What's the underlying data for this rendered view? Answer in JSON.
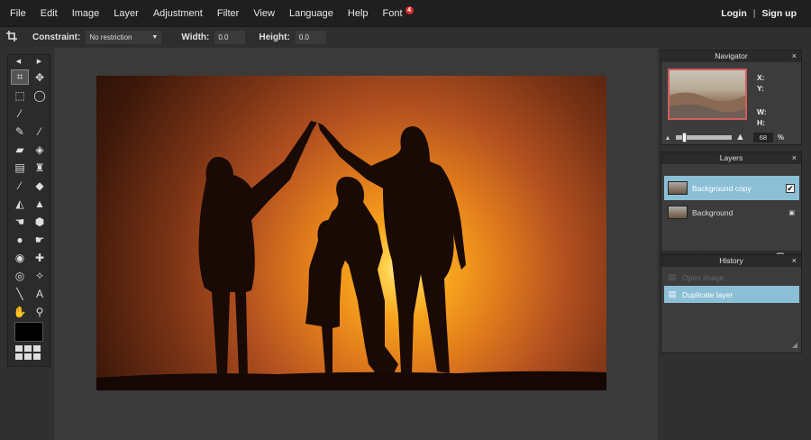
{
  "menu": {
    "items": [
      "File",
      "Edit",
      "Image",
      "Layer",
      "Adjustment",
      "Filter",
      "View",
      "Language",
      "Help",
      "Font"
    ],
    "font_badge": "4",
    "login": "Login",
    "separator": "|",
    "signup": "Sign up"
  },
  "options": {
    "constraint_label": "Constraint:",
    "constraint_value": "No restriction",
    "width_label": "Width:",
    "width_value": "0.0",
    "height_label": "Height:",
    "height_value": "0.0"
  },
  "toolbox": {
    "nav_prev": "◀",
    "nav_next": "▶",
    "tools": [
      {
        "name": "crop-tool",
        "icon": "crop-icon",
        "glyph": "⌗",
        "active": true
      },
      {
        "name": "move-tool",
        "icon": "move-icon",
        "glyph": "✥"
      },
      {
        "name": "marquee-tool",
        "icon": "marquee-icon",
        "glyph": "⬚"
      },
      {
        "name": "lasso-tool",
        "icon": "lasso-icon",
        "glyph": "◯"
      },
      {
        "name": "magic-wand-tool",
        "icon": "magic-wand-icon",
        "glyph": "⁄"
      },
      {
        "name": "empty-slot",
        "icon": "",
        "glyph": ""
      },
      {
        "name": "pencil-tool",
        "icon": "pencil-icon",
        "glyph": "✎"
      },
      {
        "name": "brush-tool",
        "icon": "brush-icon",
        "glyph": "⁄"
      },
      {
        "name": "eraser-tool",
        "icon": "eraser-icon",
        "glyph": "▰"
      },
      {
        "name": "fill-tool",
        "icon": "bucket-icon",
        "glyph": "◈"
      },
      {
        "name": "gradient-tool",
        "icon": "gradient-icon",
        "glyph": "▤"
      },
      {
        "name": "stamp-tool",
        "icon": "stamp-icon",
        "glyph": "♜"
      },
      {
        "name": "color-picker-tool",
        "icon": "dropper-icon",
        "glyph": "⁄"
      },
      {
        "name": "replace-color-tool",
        "icon": "replace-color-icon",
        "glyph": "◆"
      },
      {
        "name": "sharpen-tool",
        "icon": "sharpen-icon",
        "glyph": "◭"
      },
      {
        "name": "blur-tool",
        "icon": "blur-drop-icon",
        "glyph": "▲"
      },
      {
        "name": "smudge-tool",
        "icon": "smudge-icon",
        "glyph": "☚"
      },
      {
        "name": "sponge-tool",
        "icon": "sponge-icon",
        "glyph": "⬢"
      },
      {
        "name": "dodge-tool",
        "icon": "dodge-icon",
        "glyph": "●"
      },
      {
        "name": "burn-tool",
        "icon": "burn-icon",
        "glyph": "☛"
      },
      {
        "name": "red-eye-tool",
        "icon": "eye-icon",
        "glyph": "◉"
      },
      {
        "name": "spot-heal-tool",
        "icon": "bandage-icon",
        "glyph": "✚"
      },
      {
        "name": "bloat-tool",
        "icon": "bloat-icon",
        "glyph": "◎"
      },
      {
        "name": "pinch-tool",
        "icon": "pinch-icon",
        "glyph": "✧"
      },
      {
        "name": "draw-tool",
        "icon": "line-icon",
        "glyph": "╲"
      },
      {
        "name": "text-tool",
        "icon": "text-icon",
        "glyph": "A"
      },
      {
        "name": "hand-tool",
        "icon": "hand-icon",
        "glyph": "✋"
      },
      {
        "name": "zoom-tool",
        "icon": "zoom-icon",
        "glyph": "⚲"
      }
    ]
  },
  "navigator": {
    "title": "Navigator",
    "close": "×",
    "x_label": "X:",
    "y_label": "Y:",
    "w_label": "W:",
    "h_label": "H:",
    "zoom_value": "68",
    "zoom_percent": "%",
    "zoom_level": 0.12
  },
  "layers": {
    "title": "Layers",
    "close": "×",
    "items": [
      {
        "name": "Background copy",
        "selected": true,
        "right": "✔"
      },
      {
        "name": "Background",
        "selected": false,
        "right": "🔒"
      }
    ],
    "footer_icons": [
      "layer-settings-icon",
      "layer-mask-icon",
      "layer-styles-icon",
      "new-layer-icon",
      "delete-layer-icon"
    ]
  },
  "history": {
    "title": "History",
    "close": "×",
    "items": [
      {
        "name": "Open image",
        "selected": false
      },
      {
        "name": "Duplicate layer",
        "selected": true
      }
    ]
  },
  "colors": {
    "accent": "#8bbfd5",
    "badge": "#d92b2b",
    "menubar": "#1f1f1f",
    "workspace": "#3a3a3a"
  }
}
